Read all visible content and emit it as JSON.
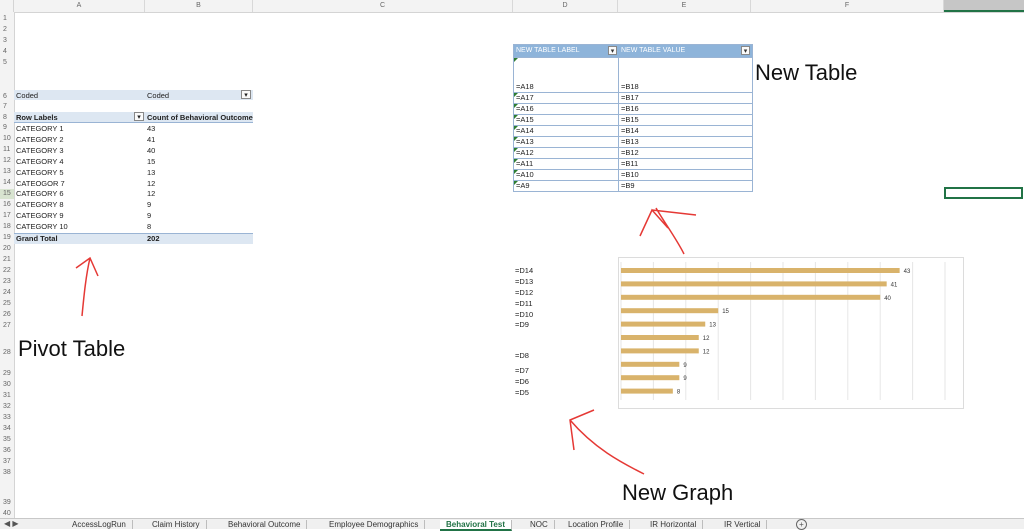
{
  "columns": [
    "A",
    "B",
    "C",
    "D",
    "E",
    "F"
  ],
  "rows": [
    "1",
    "2",
    "3",
    "4",
    "5",
    "6",
    "7",
    "8",
    "9",
    "10",
    "11",
    "12",
    "13",
    "14",
    "15",
    "16",
    "17",
    "18",
    "19",
    "20",
    "21",
    "22",
    "23",
    "24",
    "25",
    "26",
    "27",
    "28",
    "29",
    "30",
    "31",
    "32",
    "33",
    "34",
    "35",
    "36",
    "37",
    "38",
    "39",
    "40"
  ],
  "pivot": {
    "filter_label": "Coded",
    "filter_value": "Coded",
    "header_row_labels": "Row Labels",
    "header_count": "Count of Behavioral Outcome",
    "rows": [
      {
        "label": "CATEGORY 1",
        "value": "43"
      },
      {
        "label": "CATEGORY 2",
        "value": "41"
      },
      {
        "label": "CATEGORY 3",
        "value": "40"
      },
      {
        "label": "CATEGORY 4",
        "value": "15"
      },
      {
        "label": "CATEGORY 5",
        "value": "13"
      },
      {
        "label": "CATEOGOR 7",
        "value": "12"
      },
      {
        "label": "CATEGORY 6",
        "value": "12"
      },
      {
        "label": "CATEGORY 8",
        "value": "9"
      },
      {
        "label": "CATEGORY 9",
        "value": "9"
      },
      {
        "label": "CATEGORY 10",
        "value": "8"
      }
    ],
    "total_label": "Grand Total",
    "total_value": "202"
  },
  "new_table": {
    "header_label": "NEW TABLE LABEL",
    "header_value": "NEW TABLE VALUE",
    "rows": [
      {
        "label": "=A18",
        "value": "=B18"
      },
      {
        "label": "=A17",
        "value": "=B17"
      },
      {
        "label": "=A16",
        "value": "=B16"
      },
      {
        "label": "=A15",
        "value": "=B15"
      },
      {
        "label": "=A14",
        "value": "=B14"
      },
      {
        "label": "=A13",
        "value": "=B13"
      },
      {
        "label": "=A12",
        "value": "=B12"
      },
      {
        "label": "=A11",
        "value": "=B11"
      },
      {
        "label": "=A10",
        "value": "=B10"
      },
      {
        "label": "=A9",
        "value": "=B9"
      }
    ]
  },
  "graph_labels": [
    "=D14",
    "=D13",
    "=D12",
    "=D11",
    "=D10",
    "=D9",
    "=D8",
    "=D7",
    "=D6",
    "=D5"
  ],
  "annotations": {
    "new_table": "New Table",
    "pivot_table": "Pivot Table",
    "new_graph": "New Graph"
  },
  "chart_data": {
    "type": "bar",
    "orientation": "horizontal",
    "values": [
      43,
      41,
      40,
      15,
      13,
      12,
      12,
      9,
      9,
      8
    ],
    "data_labels": [
      "43",
      "41",
      "40",
      "15",
      "13",
      "12",
      "12",
      "9",
      "9",
      "8"
    ],
    "xlim": [
      0,
      50
    ],
    "grid": true,
    "bar_color": "#d9b36b"
  },
  "tabs": [
    "AccessLogRun",
    "Claim History",
    "Behavioral Outcome",
    "Employee Demographics",
    "Behavioral Test",
    "NOC",
    "Location Profile",
    "IR Horizontal",
    "IR Vertical"
  ],
  "active_tab": "Behavioral Test",
  "colors": {
    "accent": "#217346",
    "annotation": "#e53935",
    "table_header": "#8eb4da",
    "pivot_header": "#dde7f2"
  }
}
